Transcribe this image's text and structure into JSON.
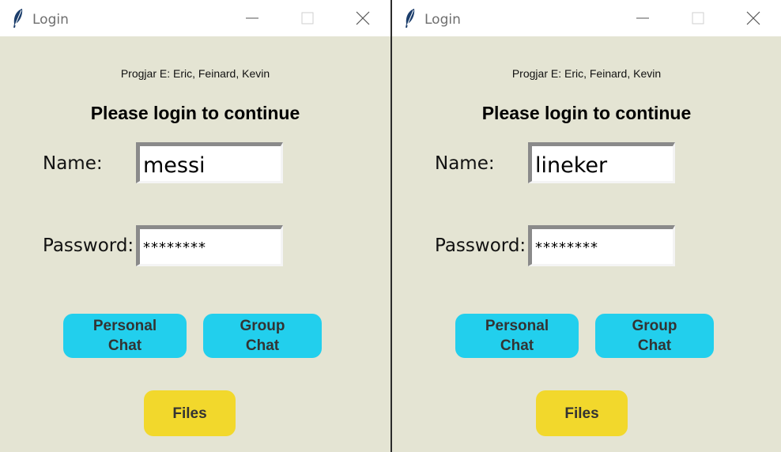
{
  "windows": [
    {
      "title": "Login",
      "credits": "Progjar E: Eric, Feinard, Kevin",
      "heading": "Please login to continue",
      "name_label": "Name:",
      "name_value": "messi",
      "password_label": "Password:",
      "password_value": "********",
      "buttons": {
        "personal": "Personal\nChat",
        "group": "Group\nChat",
        "files": "Files"
      }
    },
    {
      "title": "Login",
      "credits": "Progjar E: Eric, Feinard, Kevin",
      "heading": "Please login to continue",
      "name_label": "Name:",
      "name_value": "lineker",
      "password_label": "Password:",
      "password_value": "********",
      "buttons": {
        "personal": "Personal\nChat",
        "group": "Group\nChat",
        "files": "Files"
      }
    }
  ],
  "colors": {
    "background": "#e4e4d3",
    "chat_buttons": "#22cfed",
    "files_button": "#f2d82c"
  },
  "icons": {
    "app": "feather-icon",
    "minimize": "minimize-icon",
    "maximize": "maximize-icon",
    "close": "close-icon"
  }
}
